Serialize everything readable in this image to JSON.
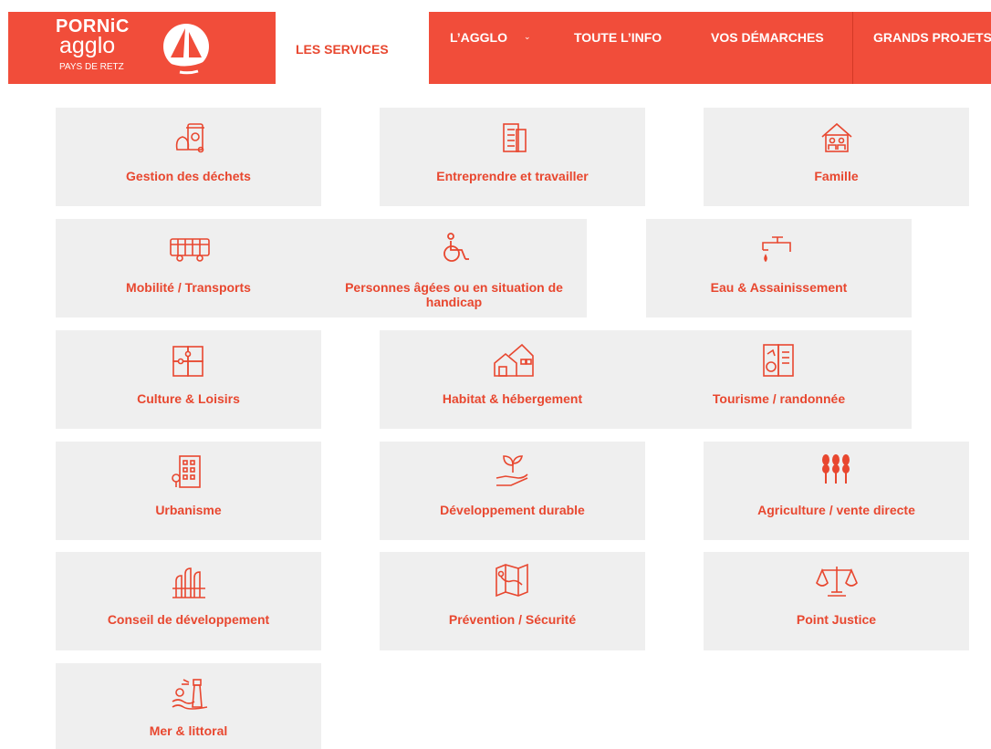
{
  "header": {
    "logo": {
      "line1": "PORNiC",
      "line2": "agglo",
      "line3": "PAYS DE RETZ"
    },
    "nav": [
      {
        "label": "LES SERVICES"
      },
      {
        "label": "L’AGGLO"
      },
      {
        "label": "TOUTE L’INFO"
      },
      {
        "label": "VOS DÉMARCHES"
      },
      {
        "label": "GRANDS PROJETS"
      }
    ],
    "chevron": "⌄"
  },
  "tiles": [
    {
      "label": "Gestion des déchets",
      "icon": "trash-bin-icon"
    },
    {
      "label": "Entreprendre et travailler",
      "icon": "office-building-icon"
    },
    {
      "label": "Famille",
      "icon": "family-house-icon"
    },
    {
      "label": "Mobilité / Transports",
      "icon": "bus-icon"
    },
    {
      "label": "Personnes âgées ou en situation de handicap",
      "icon": "wheelchair-icon"
    },
    {
      "label": "Eau & Assainissement",
      "icon": "water-tap-icon"
    },
    {
      "label": "Culture & Loisirs",
      "icon": "puzzle-icon"
    },
    {
      "label": "Habitat & hébergement",
      "icon": "houses-icon"
    },
    {
      "label": "Tourisme / randonnée",
      "icon": "tourism-brochure-icon"
    },
    {
      "label": "Urbanisme",
      "icon": "city-building-icon"
    },
    {
      "label": "Développement durable",
      "icon": "plant-hand-icon"
    },
    {
      "label": "Agriculture / vente directe",
      "icon": "wheat-icon"
    },
    {
      "label": "Conseil de développement",
      "icon": "raised-hands-icon"
    },
    {
      "label": "Prévention / Sécurité",
      "icon": "map-icon"
    },
    {
      "label": "Point Justice",
      "icon": "scales-icon"
    },
    {
      "label": "Mer & littoral",
      "icon": "lighthouse-icon"
    }
  ],
  "colors": {
    "brand": "#f14d3a",
    "tile_bg": "#efefef",
    "text_accent": "#e8472f"
  }
}
